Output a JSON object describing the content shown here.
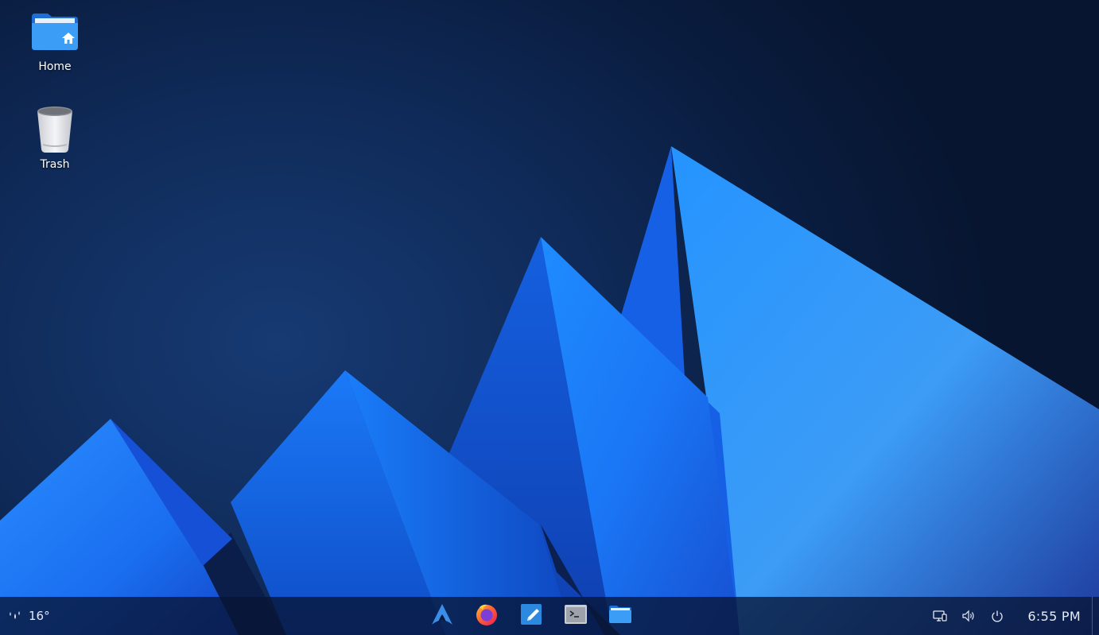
{
  "desktop": {
    "icons": [
      {
        "label": "Home",
        "icon": "home-folder-icon"
      },
      {
        "label": "Trash",
        "icon": "trash-icon"
      }
    ]
  },
  "panel": {
    "weather": {
      "temperature": "16°",
      "icon": "rain-icon"
    },
    "tasks": [
      {
        "icon": "arch-launcher-icon",
        "app": "Application Launcher"
      },
      {
        "icon": "firefox-icon",
        "app": "Firefox"
      },
      {
        "icon": "text-editor-icon",
        "app": "Text Editor"
      },
      {
        "icon": "terminal-icon",
        "app": "Terminal"
      },
      {
        "icon": "file-manager-icon",
        "app": "File Manager"
      }
    ],
    "tray": [
      "network-icon",
      "volume-icon",
      "power-icon"
    ],
    "clock": "6:55 PM"
  },
  "colors": {
    "accent": "#1e8cff",
    "panel_bg": "#081434"
  }
}
